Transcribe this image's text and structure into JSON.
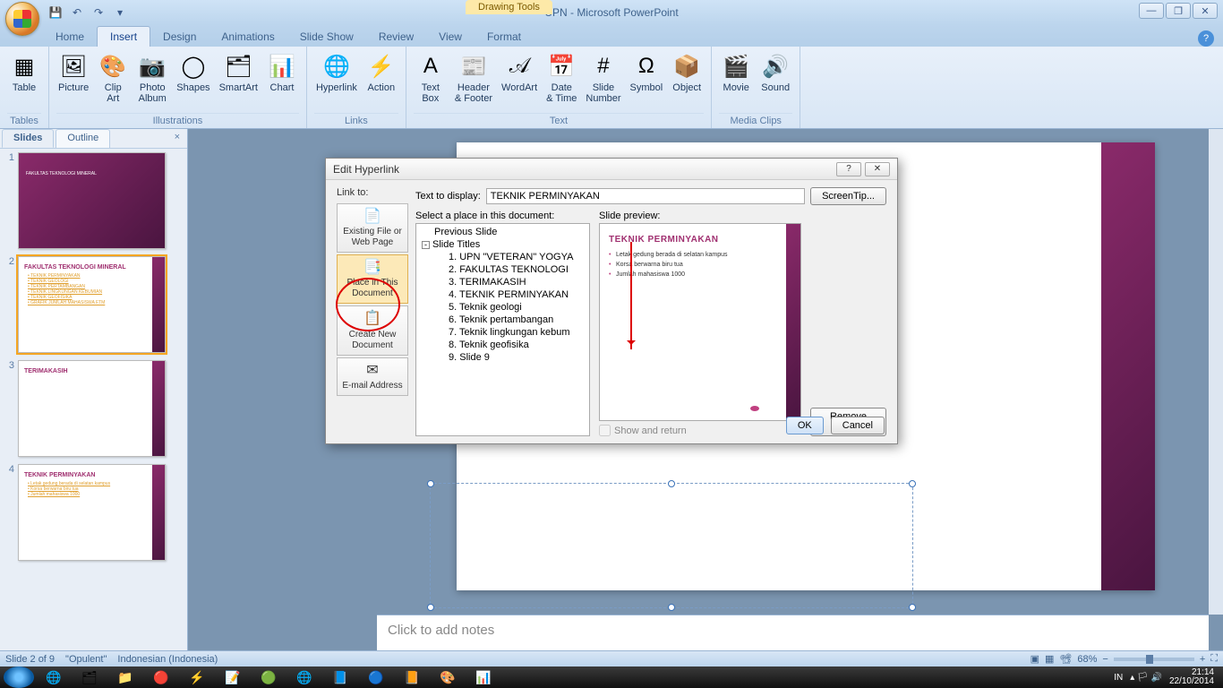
{
  "title": "UPN - Microsoft PowerPoint",
  "context_tab": "Drawing Tools",
  "win_controls": {
    "min": "—",
    "max": "❐",
    "close": "✕"
  },
  "qat": [
    "💾",
    "↶",
    "↷",
    "▾"
  ],
  "menu_tabs": [
    "Home",
    "Insert",
    "Design",
    "Animations",
    "Slide Show",
    "Review",
    "View",
    "Format"
  ],
  "menu_active": "Insert",
  "ribbon": {
    "groups": [
      {
        "title": "Tables",
        "items": [
          {
            "icon": "▦",
            "label": "Table"
          }
        ]
      },
      {
        "title": "Illustrations",
        "items": [
          {
            "icon": "🖼",
            "label": "Picture"
          },
          {
            "icon": "🎨",
            "label": "Clip\nArt"
          },
          {
            "icon": "📷",
            "label": "Photo\nAlbum"
          },
          {
            "icon": "◯",
            "label": "Shapes"
          },
          {
            "icon": "🗂",
            "label": "SmartArt"
          },
          {
            "icon": "📊",
            "label": "Chart"
          }
        ]
      },
      {
        "title": "Links",
        "items": [
          {
            "icon": "🌐",
            "label": "Hyperlink"
          },
          {
            "icon": "⚡",
            "label": "Action"
          }
        ]
      },
      {
        "title": "Text",
        "items": [
          {
            "icon": "A",
            "label": "Text\nBox"
          },
          {
            "icon": "📰",
            "label": "Header\n& Footer"
          },
          {
            "icon": "𝒜",
            "label": "WordArt"
          },
          {
            "icon": "📅",
            "label": "Date\n& Time"
          },
          {
            "icon": "#",
            "label": "Slide\nNumber"
          },
          {
            "icon": "Ω",
            "label": "Symbol"
          },
          {
            "icon": "📦",
            "label": "Object"
          }
        ]
      },
      {
        "title": "Media Clips",
        "items": [
          {
            "icon": "🎬",
            "label": "Movie"
          },
          {
            "icon": "🔊",
            "label": "Sound"
          }
        ]
      }
    ]
  },
  "side": {
    "tabs": [
      "Slides",
      "Outline"
    ],
    "active": "Slides"
  },
  "thumbs": [
    {
      "n": "1",
      "title": "",
      "lines": [
        "FAKULTAS TEKNOLOGI MINERAL"
      ],
      "bg": "purple"
    },
    {
      "n": "2",
      "title": "FAKULTAS TEKNOLOGI MINERAL",
      "lines": [
        "TEKNIK PERMINYAKAN",
        "TEKNIK GEOLOGI",
        "TEKNIK PERTAMBANGAN",
        "TEKNIK LINGKUNGAN KEBUMIAN",
        "TEKNIK GEOFISIKA",
        "GRAFIK JUMLAH MAHASISWA FTM"
      ],
      "selected": true
    },
    {
      "n": "3",
      "title": "TERIMAKASIH",
      "lines": []
    },
    {
      "n": "4",
      "title": "TEKNIK PERMINYAKAN",
      "lines": [
        "Letak gedung berada di selatan kampus",
        "Korsa berwarna biru tua",
        "Jumlah mahasiswa 1000"
      ]
    }
  ],
  "notes_placeholder": "Click to add notes",
  "dialog": {
    "title": "Edit Hyperlink",
    "help": "?",
    "close": "✕",
    "linkto_label": "Link to:",
    "linkto": [
      {
        "icon": "📄",
        "label": "Existing File or\nWeb Page"
      },
      {
        "icon": "📑",
        "label": "Place in This\nDocument",
        "active": true
      },
      {
        "icon": "📋",
        "label": "Create New\nDocument"
      },
      {
        "icon": "✉",
        "label": "E-mail Address"
      }
    ],
    "text_display_label": "Text to display:",
    "text_display": "TEKNIK PERMINYAKAN",
    "screentip": "ScreenTip...",
    "select_label": "Select a place in this document:",
    "preview_label": "Slide preview:",
    "tree": [
      {
        "lvl": 1,
        "t": "Previous Slide"
      },
      {
        "lvl": 1,
        "t": "Slide Titles",
        "exp": "-"
      },
      {
        "lvl": 2,
        "t": "1. UPN \"VETERAN\" YOGYA"
      },
      {
        "lvl": 2,
        "t": "2. FAKULTAS TEKNOLOGI"
      },
      {
        "lvl": 2,
        "t": "3. TERIMAKASIH"
      },
      {
        "lvl": 2,
        "t": "4. TEKNIK PERMINYAKAN"
      },
      {
        "lvl": 2,
        "t": "5. Teknik geologi"
      },
      {
        "lvl": 2,
        "t": "6. Teknik pertambangan"
      },
      {
        "lvl": 2,
        "t": "7. Teknik lingkungan kebum"
      },
      {
        "lvl": 2,
        "t": "8. Teknik geofisika"
      },
      {
        "lvl": 2,
        "t": "9. Slide 9"
      }
    ],
    "preview": {
      "title": "TEKNIK PERMINYAKAN",
      "lines": [
        "Letak gedung berada di selatan kampus",
        "Korsa berwarna biru tua",
        "Jumlah mahasiswa 1000"
      ]
    },
    "show_return": "Show and return",
    "remove": "Remove Link",
    "ok": "OK",
    "cancel": "Cancel"
  },
  "status": {
    "slide": "Slide 2 of 9",
    "theme": "\"Opulent\"",
    "lang": "Indonesian (Indonesia)",
    "zoom": "68%"
  },
  "taskbar": {
    "apps": [
      "🌐",
      "🗂",
      "📁",
      "🔴",
      "⚡",
      "📝",
      "🟢",
      "🌐",
      "📘",
      "🔵",
      "📙",
      "🎨",
      "📊"
    ],
    "lang": "IN",
    "icons": [
      "▴",
      "🏳",
      "🔊"
    ],
    "time": "21:14",
    "date": "22/10/2014"
  }
}
